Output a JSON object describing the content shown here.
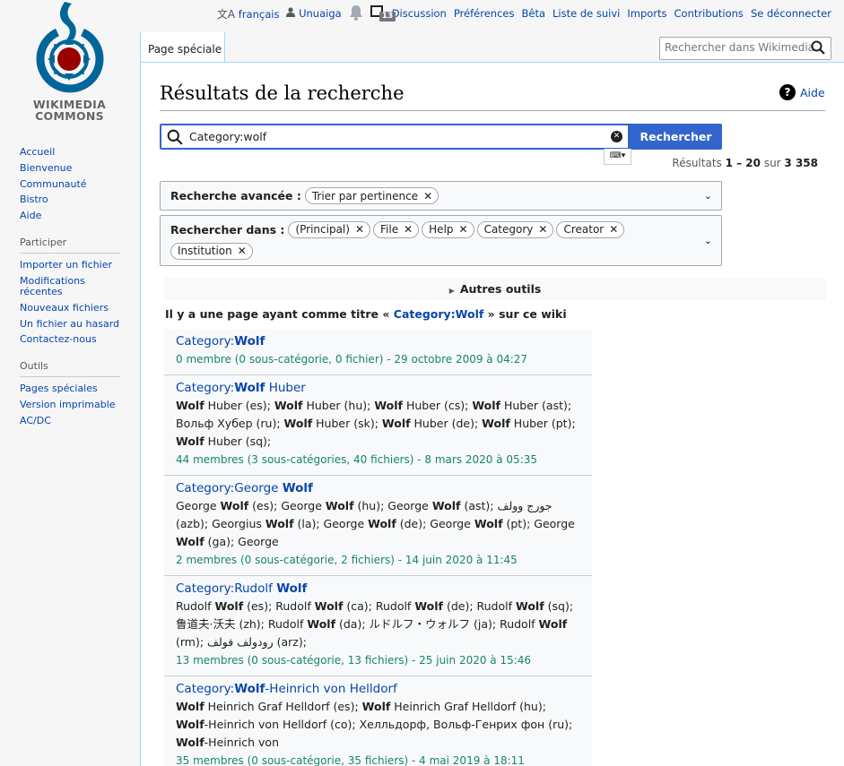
{
  "logo": {
    "line1": "WIKIMEDIA",
    "line2": "COMMONS"
  },
  "sidebar": {
    "nav": [
      "Accueil",
      "Bienvenue",
      "Communauté",
      "Bistro",
      "Aide"
    ],
    "participate_heading": "Participer",
    "participate": [
      "Importer un fichier",
      "Modifications récentes",
      "Nouveaux fichiers",
      "Un fichier au hasard",
      "Contactez-nous"
    ],
    "tools_heading": "Outils",
    "tools": [
      "Pages spéciales",
      "Version imprimable",
      "AC/DC"
    ]
  },
  "personal": {
    "language": "français",
    "user": "Unuaiga",
    "notice_count": "13",
    "links": [
      "Discussion",
      "Préférences",
      "Bêta",
      "Liste de suivi",
      "Imports",
      "Contributions",
      "Se déconnecter"
    ]
  },
  "tab": "Page spéciale",
  "header_search_placeholder": "Rechercher dans Wikimedia",
  "page_title": "Résultats de la recherche",
  "help": "Aide",
  "search": {
    "value": "Category:wolf",
    "button": "Rechercher"
  },
  "results_info": {
    "prefix": "Résultats ",
    "range": "1 – 20",
    "mid": " sur ",
    "total": "3 358"
  },
  "advanced": {
    "label": "Recherche avancée :",
    "chips": [
      "Trier par pertinence"
    ]
  },
  "namespaces": {
    "label": "Rechercher dans :",
    "chips": [
      "(Principal)",
      "File",
      "Help",
      "Category",
      "Creator",
      "Institution"
    ]
  },
  "other_tools": "Autres outils",
  "exact_match": {
    "prefix": "Il y a une page ayant comme titre « ",
    "link": "Category:Wolf",
    "suffix": " » sur ce wiki"
  },
  "results": [
    {
      "title": [
        {
          "t": "Category:",
          "b": false
        },
        {
          "t": "Wolf",
          "b": true
        }
      ],
      "snippet": [],
      "meta": "0 membre (0 sous-catégorie, 0 fichier) - 29 octobre 2009 à 04:27"
    },
    {
      "title": [
        {
          "t": "Category:",
          "b": false
        },
        {
          "t": "Wolf",
          "b": true
        },
        {
          "t": " Huber",
          "b": false
        }
      ],
      "snippet": [
        {
          "t": "Wolf",
          "b": true
        },
        {
          "t": " Huber (es); ",
          "b": false
        },
        {
          "t": "Wolf",
          "b": true
        },
        {
          "t": " Huber (hu); ",
          "b": false
        },
        {
          "t": "Wolf",
          "b": true
        },
        {
          "t": " Huber (cs); ",
          "b": false
        },
        {
          "t": "Wolf",
          "b": true
        },
        {
          "t": " Huber (ast); Вольф Хубер (ru); ",
          "b": false
        },
        {
          "t": "Wolf",
          "b": true
        },
        {
          "t": " Huber (sk); ",
          "b": false
        },
        {
          "t": "Wolf",
          "b": true
        },
        {
          "t": " Huber (de); ",
          "b": false
        },
        {
          "t": "Wolf",
          "b": true
        },
        {
          "t": " Huber (pt); ",
          "b": false
        },
        {
          "t": "Wolf",
          "b": true
        },
        {
          "t": " Huber (sq);",
          "b": false
        }
      ],
      "meta": "44 membres (3 sous-catégories, 40 fichiers) - 8 mars 2020 à 05:35"
    },
    {
      "title": [
        {
          "t": "Category:George ",
          "b": false
        },
        {
          "t": "Wolf",
          "b": true
        }
      ],
      "snippet": [
        {
          "t": "George ",
          "b": false
        },
        {
          "t": "Wolf",
          "b": true
        },
        {
          "t": " (es); George ",
          "b": false
        },
        {
          "t": "Wolf",
          "b": true
        },
        {
          "t": " (hu); George ",
          "b": false
        },
        {
          "t": "Wolf",
          "b": true
        },
        {
          "t": " (ast); جورج وولف (azb); Georgius ",
          "b": false
        },
        {
          "t": "Wolf",
          "b": true
        },
        {
          "t": " (la); George ",
          "b": false
        },
        {
          "t": "Wolf",
          "b": true
        },
        {
          "t": " (de); George ",
          "b": false
        },
        {
          "t": "Wolf",
          "b": true
        },
        {
          "t": " (pt); George ",
          "b": false
        },
        {
          "t": "Wolf",
          "b": true
        },
        {
          "t": " (ga); George",
          "b": false
        }
      ],
      "meta": "2 membres (0 sous-catégorie, 2 fichiers) - 14 juin 2020 à 11:45"
    },
    {
      "title": [
        {
          "t": "Category:Rudolf ",
          "b": false
        },
        {
          "t": "Wolf",
          "b": true
        }
      ],
      "snippet": [
        {
          "t": "Rudolf ",
          "b": false
        },
        {
          "t": "Wolf",
          "b": true
        },
        {
          "t": " (es); Rudolf ",
          "b": false
        },
        {
          "t": "Wolf",
          "b": true
        },
        {
          "t": " (ca); Rudolf ",
          "b": false
        },
        {
          "t": "Wolf",
          "b": true
        },
        {
          "t": " (de); Rudolf ",
          "b": false
        },
        {
          "t": "Wolf",
          "b": true
        },
        {
          "t": " (sq); 鲁道夫·沃夫 (zh); Rudolf ",
          "b": false
        },
        {
          "t": "Wolf",
          "b": true
        },
        {
          "t": " (da); ルドルフ・ウォルフ (ja); Rudolf ",
          "b": false
        },
        {
          "t": "Wolf",
          "b": true
        },
        {
          "t": " (rm); رودولف فولف (arz);",
          "b": false
        }
      ],
      "meta": "13 membres (0 sous-catégorie, 13 fichiers) - 25 juin 2020 à 15:46"
    },
    {
      "title": [
        {
          "t": "Category:",
          "b": false
        },
        {
          "t": "Wolf",
          "b": true
        },
        {
          "t": "-Heinrich von Helldorf",
          "b": false
        }
      ],
      "snippet": [
        {
          "t": "Wolf",
          "b": true
        },
        {
          "t": " Heinrich Graf Helldorf (es); ",
          "b": false
        },
        {
          "t": "Wolf",
          "b": true
        },
        {
          "t": " Heinrich Graf Helldorf (hu); ",
          "b": false
        },
        {
          "t": "Wolf",
          "b": true
        },
        {
          "t": "-Heinrich von Helldorf (co); Хелльдорф, Вольф-Генрих фон (ru); ",
          "b": false
        },
        {
          "t": "Wolf",
          "b": true
        },
        {
          "t": "-Heinrich von",
          "b": false
        }
      ],
      "meta": "35 membres (0 sous-catégorie, 35 fichiers) - 4 mai 2019 à 18:11"
    }
  ]
}
